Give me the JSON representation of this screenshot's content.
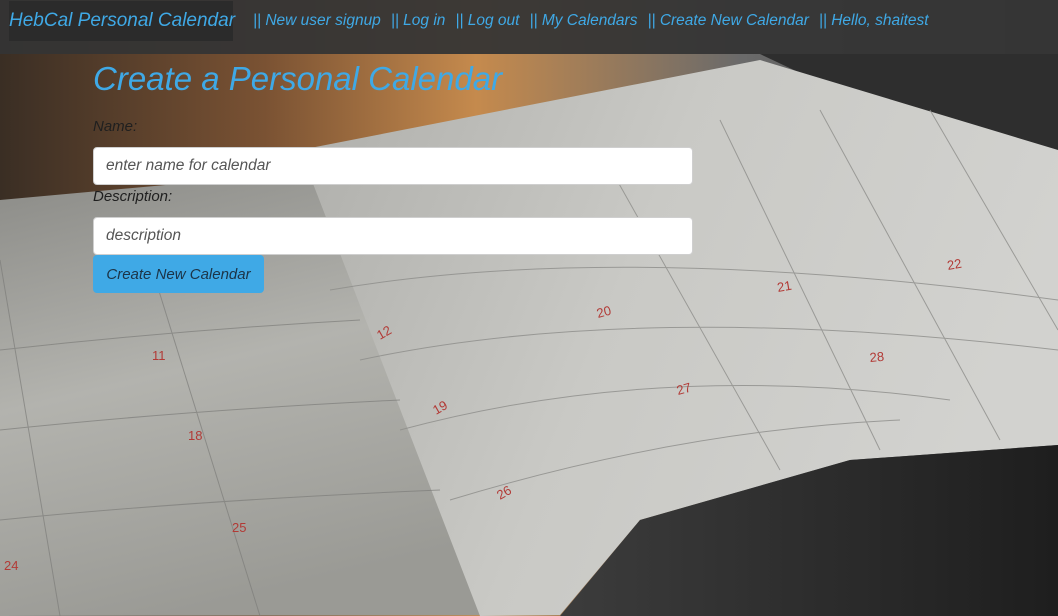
{
  "navbar": {
    "brand": "HebCal Personal Calendar",
    "links": [
      "|| New user signup",
      "|| Log in",
      "|| Log out",
      "|| My Calendars",
      "|| Create New Calendar",
      "|| Hello, shaitest"
    ]
  },
  "form": {
    "title": "Create a Personal Calendar",
    "name_label": "Name:",
    "name_placeholder": "enter name for calendar",
    "description_label": "Description:",
    "description_placeholder": "description",
    "submit_label": "Create New Calendar"
  },
  "background": {
    "calendar_numbers": [
      "11",
      "12",
      "18",
      "19",
      "20",
      "21",
      "22",
      "25",
      "26",
      "27",
      "28",
      "24"
    ]
  },
  "colors": {
    "accent": "#3fa9e6",
    "navbar_bg": "#343434",
    "brand_bg": "#2b2b2b"
  }
}
